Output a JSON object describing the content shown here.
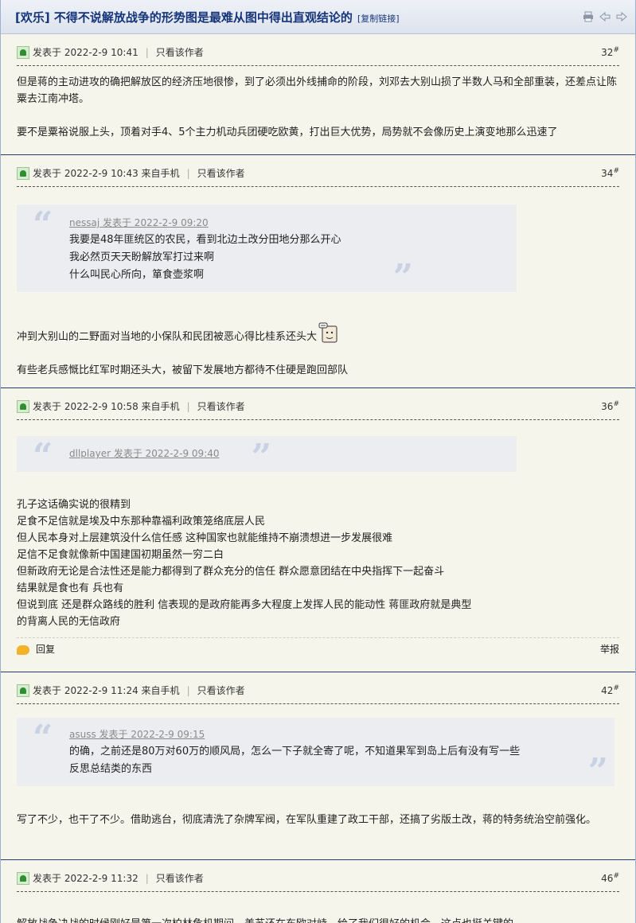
{
  "thread": {
    "title": "[欢乐] 不得不说解放战争的形势图是最难从图中得出直观结论的",
    "copy_link": "[复制链接]"
  },
  "labels": {
    "posted": "发表于",
    "author_only": "只看该作者",
    "reply": "回复",
    "report": "举报"
  },
  "posts": [
    {
      "time": "2022-2-9 10:41",
      "source": "",
      "floor": "32",
      "paragraphs": [
        "但是蒋的主动进攻的确把解放区的经济压地很惨，到了必须出外线捕命的阶段，刘邓去大别山损了半数人马和全部重装，还差点让陈粟去江南冲塔。",
        "要不是粟裕说服上头，顶着对手4、5个主力机动兵团硬吃欧黄，打出巨大优势，局势就不会像历史上演变地那么迅速了"
      ]
    },
    {
      "time": "2022-2-9 10:43",
      "source": "来自手机",
      "floor": "34",
      "quote": {
        "author": "nessaj 发表于 2022-2-9 09:20",
        "lines": [
          "我要是48年匪统区的农民，看到北边土改分田地分那么开心",
          "我必然页天天盼解放军打过来啊",
          "什么叫民心所向，箪食壶浆啊"
        ]
      },
      "paragraphs": [
        "冲到大别山的二野面对当地的小保队和民团被恶心得比桂系还头大",
        "有些老兵感慨比红军时期还头大，被留下发展地方都待不住硬是跑回部队"
      ]
    },
    {
      "time": "2022-2-9 10:58",
      "source": "来自手机",
      "floor": "36",
      "quote": {
        "author": "dllplayer 发表于 2022-2-9 09:40",
        "lines": []
      },
      "paragraphs": [
        "孔子这话确实说的很精到",
        "足食不足信就是埃及中东那种靠福利政策笼络底层人民",
        "但人民本身对上层建筑没什么信任感 这种国家也就能维持不崩溃想进一步发展很难",
        "足信不足食就像新中国建国初期虽然一穷二白",
        "但新政府无论是合法性还是能力都得到了群众充分的信任 群众愿意团结在中央指挥下一起奋斗",
        "结果就是食也有 兵也有",
        "但说到底 还是群众路线的胜利 信表现的是政府能再多大程度上发挥人民的能动性 蒋匪政府就是典型",
        "的背离人民的无信政府"
      ]
    },
    {
      "time": "2022-2-9 11:24",
      "source": "来自手机",
      "floor": "42",
      "quote": {
        "author": "asuss 发表于 2022-2-9 09:15",
        "lines": [
          "的确，之前还是80万对60万的顺风局，怎么一下子就全寄了呢，不知道果军到岛上后有没有写一些",
          "反思总结类的东西"
        ]
      },
      "paragraphs": [
        "写了不少，也干了不少。借助逃台，彻底清洗了杂牌军阀，在军队重建了政工干部，还搞了劣版土改，蒋的特务统治空前强化。"
      ]
    },
    {
      "time": "2022-2-9 11:32",
      "source": "",
      "floor": "46",
      "paragraphs": [
        "解放战争决战的时候刚好是第一次柏林危机期间，美苏还在东欧对峙，给了我们很好的机会。这点也挺关键的"
      ]
    }
  ]
}
